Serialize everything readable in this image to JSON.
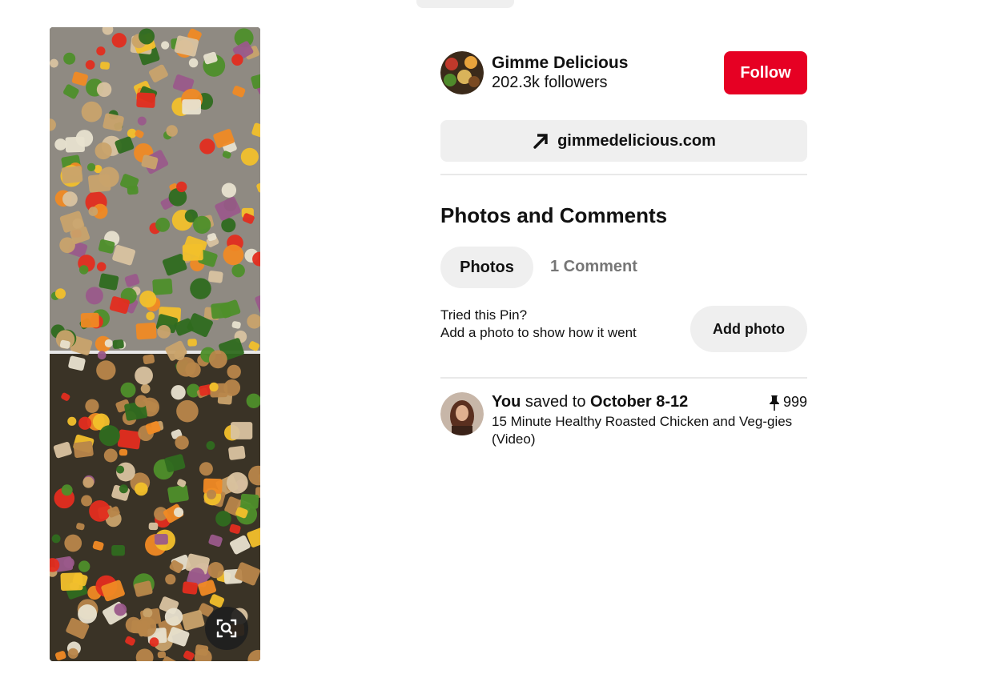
{
  "pin": {
    "image_alt": "15 Minute Healthy Roasted Chicken and Veggies",
    "lens_icon": "visual-search-icon"
  },
  "creator": {
    "name": "Gimme Delicious",
    "followers": "202.3k followers",
    "follow_label": "Follow",
    "follow_color": "#e60023"
  },
  "site": {
    "link_text": "gimmedelicious.com",
    "icon": "arrow-up-right-icon"
  },
  "section": {
    "title": "Photos and Comments",
    "tabs": [
      {
        "label": "Photos",
        "active": true
      },
      {
        "label": "1 Comment",
        "active": false
      }
    ]
  },
  "tried": {
    "line1": "Tried this Pin?",
    "line2": "Add a photo to show how it went",
    "button_label": "Add photo"
  },
  "saved": {
    "who": "You",
    "verb": "saved to",
    "board": "October 8-12",
    "pin_title": "15 Minute Healthy Roasted Chicken and Veg-gies (Video)",
    "pin_count": "999",
    "pin_icon": "pushpin-icon"
  }
}
